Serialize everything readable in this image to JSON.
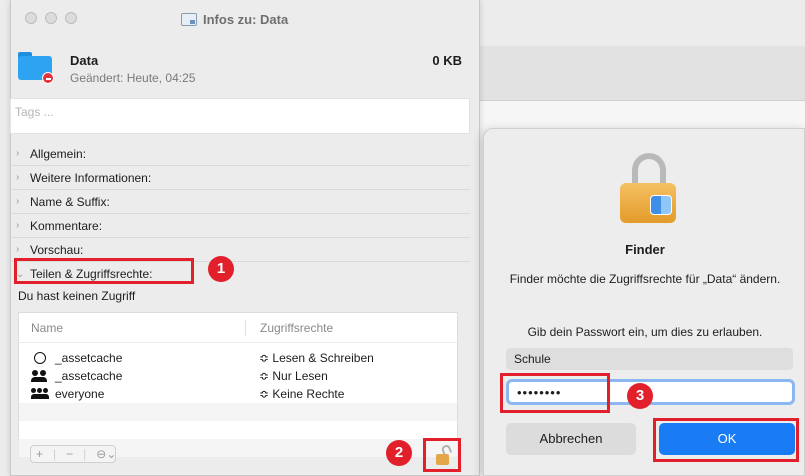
{
  "info_window": {
    "title": "Infos zu: Data",
    "file": {
      "name": "Data",
      "modified": "Geändert: Heute, 04:25",
      "size": "0 KB"
    },
    "tags_placeholder": "Tags ...",
    "sections": [
      "Allgemein:",
      "Weitere Informationen:",
      "Name & Suffix:",
      "Kommentare:",
      "Vorschau:",
      "Teilen & Zugriffsrechte:"
    ],
    "no_access_text": "Du hast keinen Zugriff",
    "permissions": {
      "headers": {
        "name": "Name",
        "rights": "Zugriffsrechte"
      },
      "rows": [
        {
          "icon": "user-icon",
          "name": "_assetcache",
          "rights": "≎ Lesen & Schreiben"
        },
        {
          "icon": "group-icon",
          "name": "_assetcache",
          "rights": "≎ Nur Lesen"
        },
        {
          "icon": "everyone-icon",
          "name": "everyone",
          "rights": "≎ Keine Rechte"
        }
      ],
      "tools": {
        "add": "+",
        "remove": "−",
        "action": "⊖⌄"
      }
    }
  },
  "auth_dialog": {
    "app": "Finder",
    "message": "Finder möchte die Zugriffsrechte für „Data“ ändern.",
    "prompt": "Gib dein Passwort ein, um dies zu erlauben.",
    "username": "Schule",
    "password_mask": "••••••••",
    "cancel_label": "Abbrechen",
    "ok_label": "OK"
  },
  "annotations": [
    "1",
    "2",
    "3"
  ],
  "colors": {
    "annotation": "#e2202c",
    "ok_button": "#1a7cf5",
    "folder": "#2ea3f2"
  }
}
